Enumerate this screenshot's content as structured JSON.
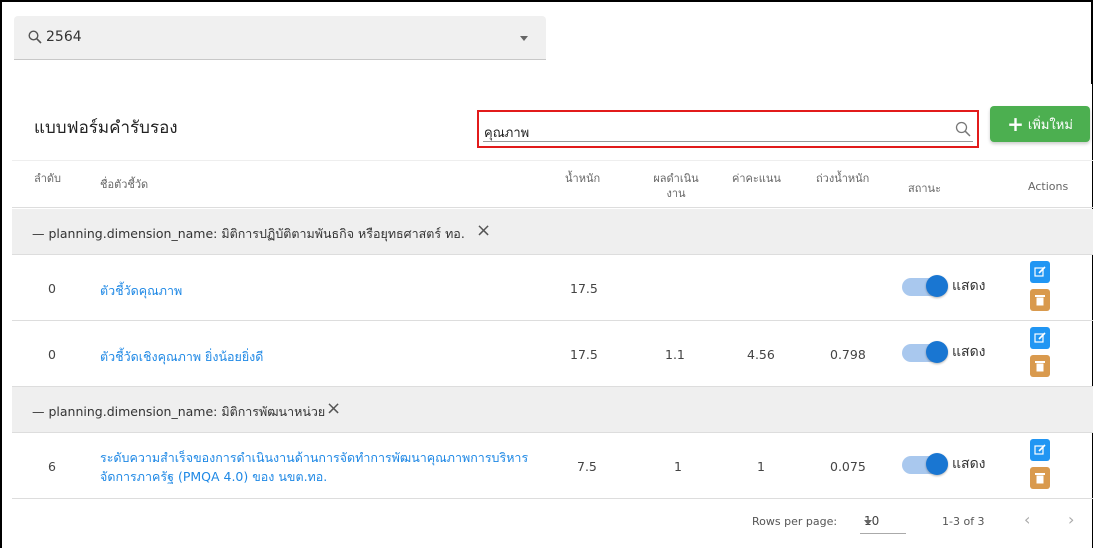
{
  "filter": {
    "value": "2564"
  },
  "card": {
    "title": "แบบฟอร์มคำรับรอง"
  },
  "search": {
    "value": "คุณภาพ"
  },
  "add_button": {
    "label": "เพิ่มใหม่"
  },
  "columns": {
    "order": "ลำดับ",
    "name": "ชื่อตัวชี้วัด",
    "weight": "น้ำหนัก",
    "result_line1": "ผลดำเนิน",
    "result_line2": "งาน",
    "score": "ค่าคะแนน",
    "weighted": "ถ่วงน้ำหนัก",
    "status": "สถานะ",
    "actions": "Actions"
  },
  "groups": [
    {
      "label": "planning.dimension_name: มิติการปฏิบัติตามพันธกิจ หรือยุทธศาสตร์ ทอ."
    },
    {
      "label": "planning.dimension_name: มิติการพัฒนาหน่วย"
    }
  ],
  "rows": [
    {
      "order": "0",
      "name": "ตัวชี้วัดคุณภาพ",
      "weight": "17.5",
      "result": "",
      "score": "",
      "weighted": "",
      "status": "แสดง",
      "status_on": true
    },
    {
      "order": "0",
      "name": "ตัวชี้วัดเชิงคุณภาพ ยิ่งน้อยยิ่งดี",
      "weight": "17.5",
      "result": "1.1",
      "score": "4.56",
      "weighted": "0.798",
      "status": "แสดง",
      "status_on": true
    },
    {
      "order": "6",
      "name_line1": "ระดับความสำเร็จของการดำเนินงานด้านการจัดทำการพัฒนาคุณภาพการบริหาร",
      "name_line2": "จัดการภาครัฐ (PMQA 4.0) ของ นขต.ทอ.",
      "weight": "7.5",
      "result": "1",
      "score": "1",
      "weighted": "0.075",
      "status": "แสดง",
      "status_on": true
    }
  ],
  "footer": {
    "rows_per_page_label": "Rows per page:",
    "rows_per_page_value": "10",
    "range": "1-3 of 3"
  },
  "colors": {
    "accent_green": "#4caf50",
    "link_blue": "#1e88e5",
    "toggle_blue": "#1976d2",
    "edit_blue": "#2196f3",
    "delete_orange": "#d99a4e",
    "highlight_red": "#e21b1b"
  },
  "icons": [
    "search-icon",
    "chevron-down-icon",
    "plus-icon",
    "close-icon",
    "edit-icon",
    "trash-icon",
    "chevron-left-icon",
    "chevron-right-icon"
  ]
}
